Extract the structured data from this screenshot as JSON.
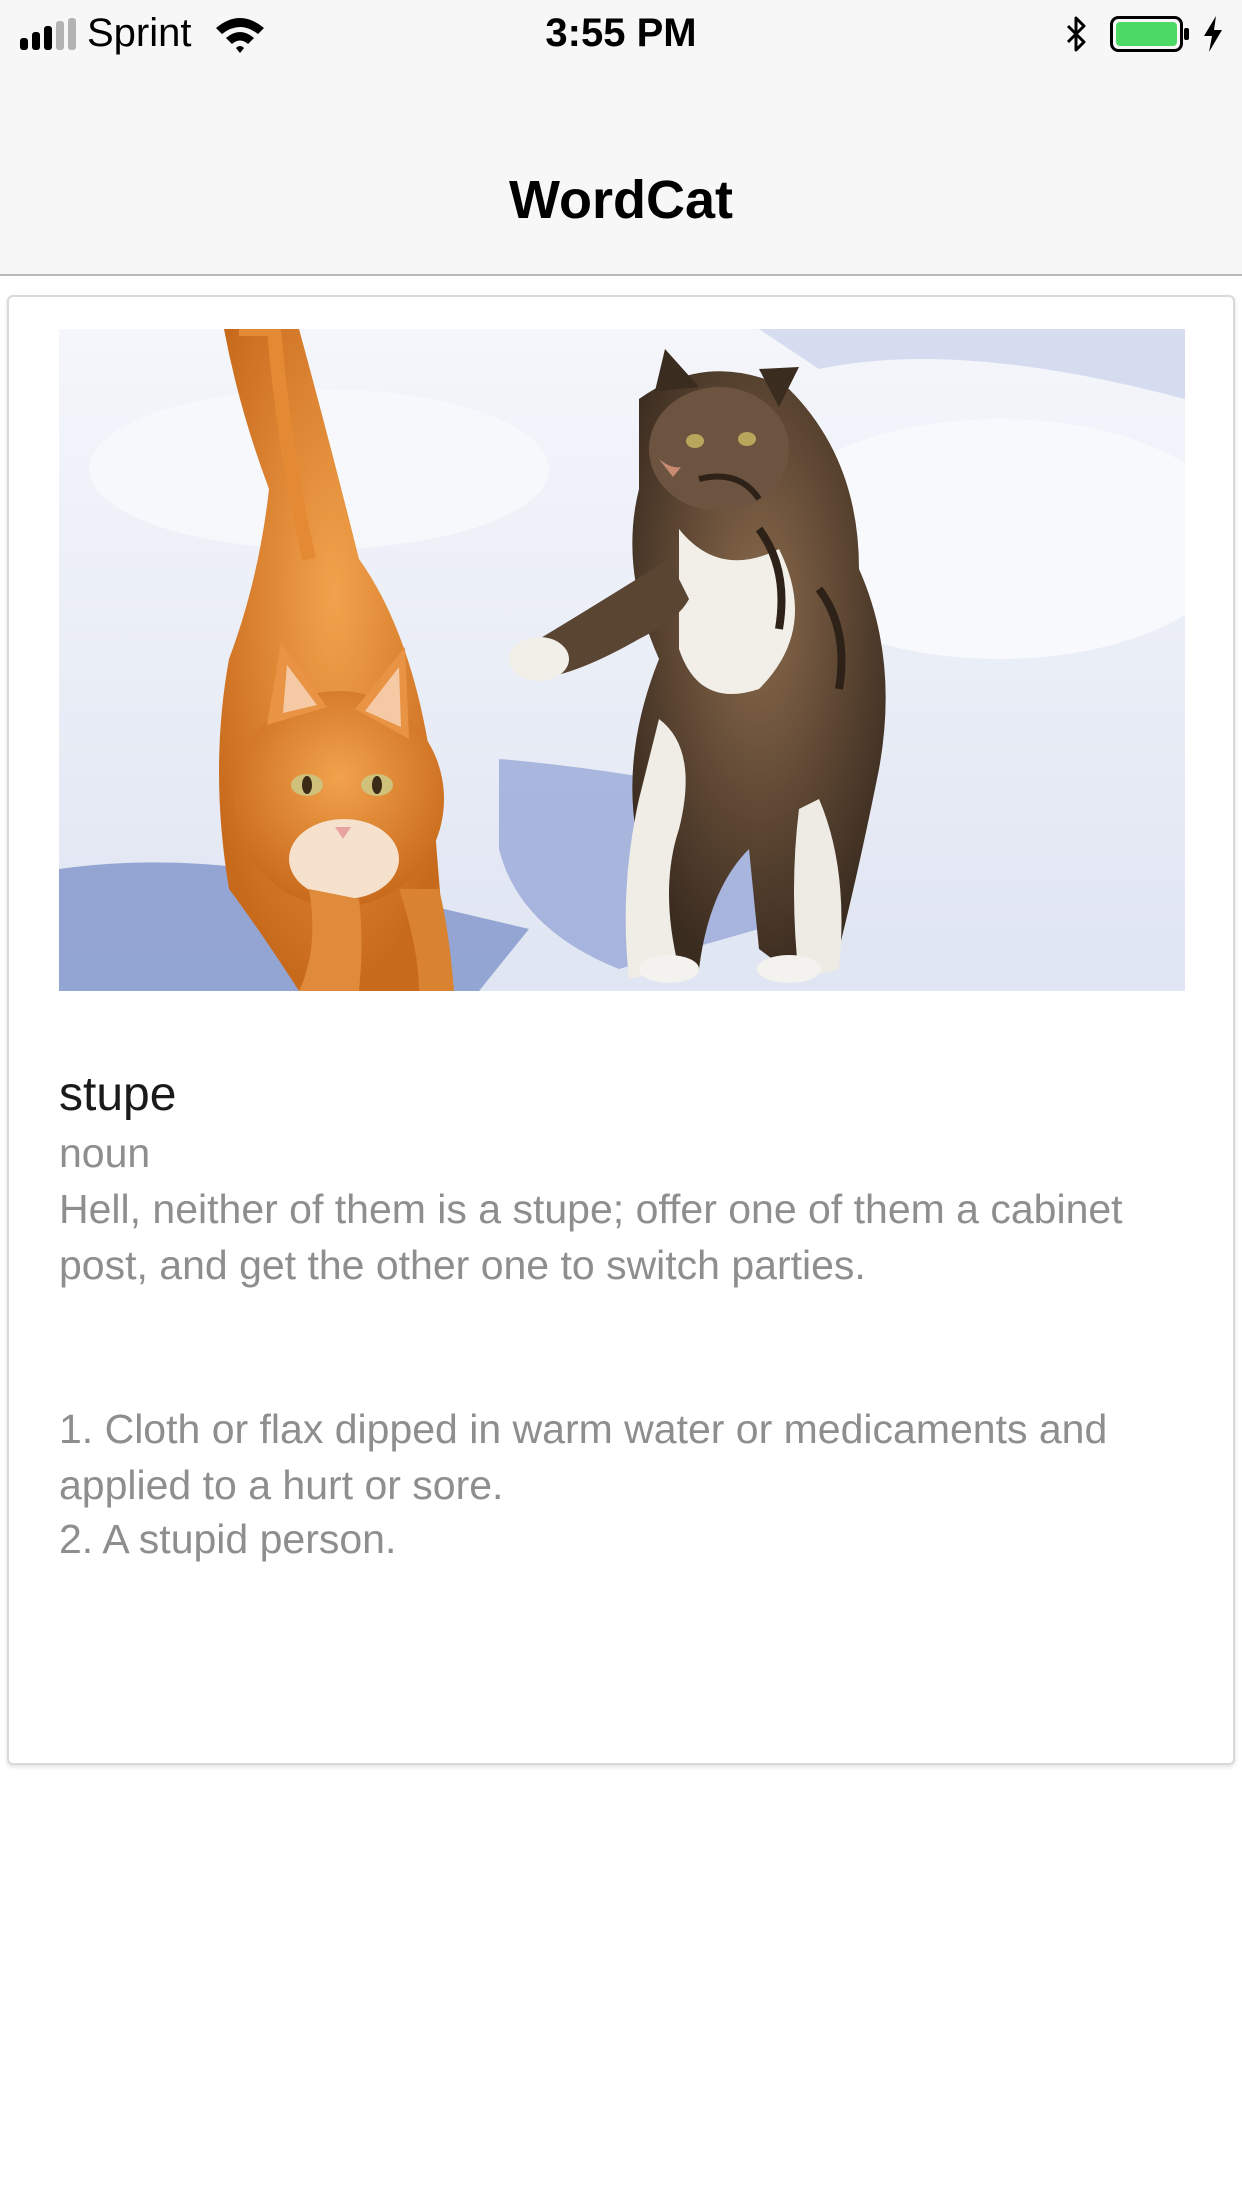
{
  "status_bar": {
    "carrier": "Sprint",
    "time": "3:55 PM",
    "battery_color": "#4cd964",
    "icons": [
      "signal-icon",
      "wifi-icon",
      "bluetooth-icon",
      "battery-icon",
      "charging-icon"
    ]
  },
  "nav": {
    "title": "WordCat"
  },
  "card": {
    "image": {
      "subject": "photo of an orange tabby cat and a brown tabby cat walking in snow"
    },
    "word": "stupe",
    "part_of_speech": "noun",
    "example": "Hell, neither of them is a stupe; offer one of them a cabinet post, and get the other one to switch parties.",
    "definitions": [
      "1. Cloth or flax dipped in warm water or medicaments and applied to a hurt or sore.",
      "2. A stupid person."
    ]
  }
}
